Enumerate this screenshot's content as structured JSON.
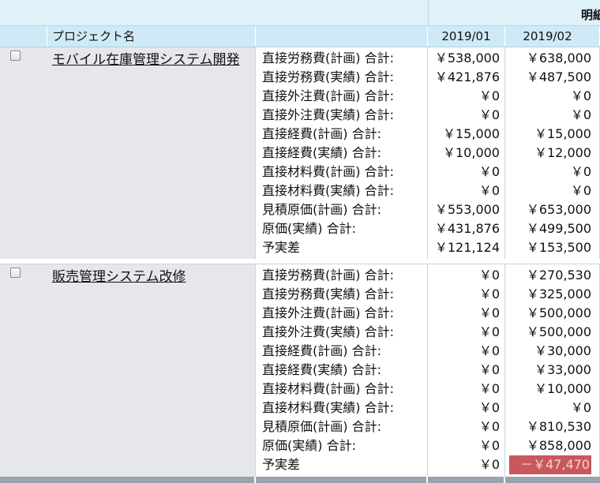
{
  "header": {
    "group_label": "明細",
    "project_name_col": "プロジェクト名",
    "months": [
      "2019/01",
      "2019/02"
    ]
  },
  "projects": [
    {
      "name": "モバイル在庫管理システム開発",
      "rows": [
        {
          "label": "直接労務費(計画) 合計:",
          "m1": "￥538,000",
          "m2": "￥638,000"
        },
        {
          "label": "直接労務費(実績) 合計:",
          "m1": "￥421,876",
          "m2": "￥487,500"
        },
        {
          "label": "直接外注費(計画) 合計:",
          "m1": "￥0",
          "m2": "￥0"
        },
        {
          "label": "直接外注費(実績) 合計:",
          "m1": "￥0",
          "m2": "￥0"
        },
        {
          "label": "直接経費(計画) 合計:",
          "m1": "￥15,000",
          "m2": "￥15,000"
        },
        {
          "label": "直接経費(実績) 合計:",
          "m1": "￥10,000",
          "m2": "￥12,000"
        },
        {
          "label": "直接材料費(計画) 合計:",
          "m1": "￥0",
          "m2": "￥0"
        },
        {
          "label": "直接材料費(実績) 合計:",
          "m1": "￥0",
          "m2": "￥0"
        },
        {
          "label": "見積原価(計画) 合計:",
          "m1": "￥553,000",
          "m2": "￥653,000"
        },
        {
          "label": "原価(実績) 合計:",
          "m1": "￥431,876",
          "m2": "￥499,500"
        },
        {
          "label": "予実差",
          "m1": "￥121,124",
          "m2": "￥153,500"
        }
      ]
    },
    {
      "name": "販売管理システム改修",
      "rows": [
        {
          "label": "直接労務費(計画) 合計:",
          "m1": "￥0",
          "m2": "￥270,530"
        },
        {
          "label": "直接労務費(実績) 合計:",
          "m1": "￥0",
          "m2": "￥325,000"
        },
        {
          "label": "直接外注費(計画) 合計:",
          "m1": "￥0",
          "m2": "￥500,000"
        },
        {
          "label": "直接外注費(実績) 合計:",
          "m1": "￥0",
          "m2": "￥500,000"
        },
        {
          "label": "直接経費(計画) 合計:",
          "m1": "￥0",
          "m2": "￥30,000"
        },
        {
          "label": "直接経費(実績) 合計:",
          "m1": "￥0",
          "m2": "￥33,000"
        },
        {
          "label": "直接材料費(計画) 合計:",
          "m1": "￥0",
          "m2": "￥10,000"
        },
        {
          "label": "直接材料費(実績) 合計:",
          "m1": "￥0",
          "m2": "￥0"
        },
        {
          "label": "見積原価(計画) 合計:",
          "m1": "￥0",
          "m2": "￥810,530"
        },
        {
          "label": "原価(実績) 合計:",
          "m1": "￥0",
          "m2": "￥858,000"
        },
        {
          "label": "予実差",
          "m1": "￥0",
          "m2": "－￥47,470",
          "m2_negative": true
        }
      ]
    }
  ],
  "colors": {
    "header_bg": "#cfeaf6",
    "left_bg": "#e6e7eb",
    "negative_bg": "#c9585d"
  }
}
